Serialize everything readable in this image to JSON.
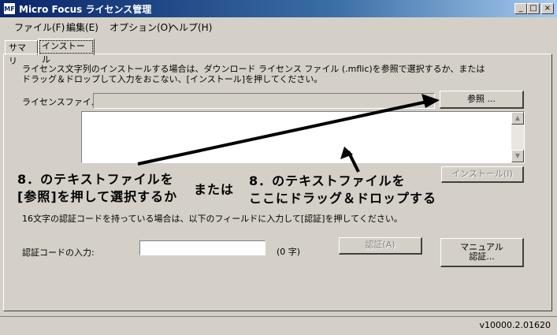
{
  "window": {
    "title": "Micro Focus ライセンス管理",
    "icon_text": "MF"
  },
  "controls": {
    "minimize": "_",
    "maximize": "□",
    "close": "×"
  },
  "menu": [
    "ファイル(F)",
    "編集(E)",
    "オプション(O)",
    "ヘルプ(H)"
  ],
  "tabs": [
    {
      "label": "サマリ",
      "active": false
    },
    {
      "label": "インストール",
      "active": true
    }
  ],
  "install": {
    "instruction_line1": "ライセンス文字列のインストールする場合は、ダウンロード ライセンス ファイル (.mflic)を参照で選択するか、または",
    "instruction_line2": "ドラッグ＆ドロップして入力をおこない、[インストール]を押してください。",
    "license_file_label": "ライセンスファイル:",
    "license_file_value": "",
    "browse_button": "参照 ...",
    "install_button": "インストール(I)"
  },
  "annotations": {
    "left_line1": "8．のテキストファイルを",
    "left_line2": "[参照]を押して選択するか",
    "middle": "または",
    "right_line1": "8．のテキストファイルを",
    "right_line2": "ここにドラッグ＆ドロップする"
  },
  "auth": {
    "instruction": "16文字の認証コードを持っている場合は、以下のフィールドに入力して[認証]を押してください。",
    "code_label": "認証コードの入力:",
    "code_value": "",
    "char_count": "(0 字)",
    "auth_button": "認証(A)",
    "manual_button_line1": "マニュアル",
    "manual_button_line2": "認証..."
  },
  "status": {
    "version": "v10000.2.01620"
  },
  "scroll": {
    "up_icon": "▲",
    "down_icon": "▼"
  }
}
